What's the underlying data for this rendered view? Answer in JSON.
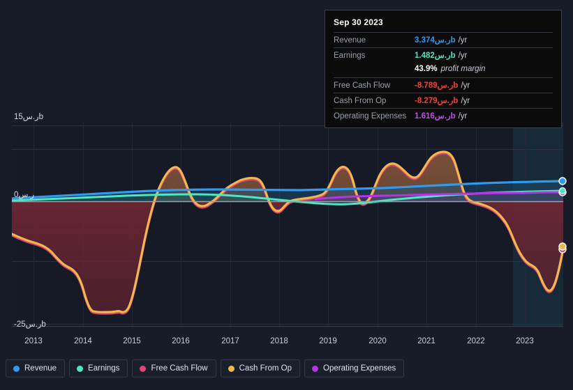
{
  "tooltip": {
    "date": "Sep 30 2023",
    "rows": [
      {
        "label": "Revenue",
        "value": "3.374ر.سb",
        "unit": "/yr",
        "color": "#2e9bf0"
      },
      {
        "label": "Earnings",
        "value": "1.482ر.سb",
        "unit": "/yr",
        "color": "#4de8c2"
      },
      {
        "label": "Free Cash Flow",
        "value": "-8.789ر.سb",
        "unit": "/yr",
        "color": "#f2413c"
      },
      {
        "label": "Cash From Op",
        "value": "-8.279ر.سb",
        "unit": "/yr",
        "color": "#f2413c"
      },
      {
        "label": "Operating Expenses",
        "value": "1.616ر.سb",
        "unit": "/yr",
        "color": "#c44ef0"
      }
    ],
    "margin_value": "43.9%",
    "margin_label": "profit margin"
  },
  "axes": {
    "y_top_label": "15ر.سb",
    "y_zero_label": "0ر.س",
    "y_bottom_label": "-25ر.سb",
    "x_labels": [
      "2013",
      "2014",
      "2015",
      "2016",
      "2017",
      "2018",
      "2019",
      "2020",
      "2021",
      "2022",
      "2023"
    ]
  },
  "legend": [
    {
      "label": "Revenue",
      "color": "#2e9bf0"
    },
    {
      "label": "Earnings",
      "color": "#4de8c2"
    },
    {
      "label": "Free Cash Flow",
      "color": "#e0457b"
    },
    {
      "label": "Cash From Op",
      "color": "#f2b84b"
    },
    {
      "label": "Operating Expenses",
      "color": "#b832e8"
    }
  ],
  "colors": {
    "revenue": "#2e9bf0",
    "earnings": "#4de8c2",
    "free_cash_flow": "#e0457b",
    "cash_from_op": "#f2b84b",
    "operating_expenses": "#b832e8",
    "page_background": "#171c28",
    "plot_background": "#151a26",
    "gridline": "#2a3140",
    "zero_line": "#9aa0ab",
    "negative_fill": "#6b2430",
    "forecast_band": "#18303c"
  },
  "chart_data": {
    "type": "area",
    "title": "",
    "xlabel": "",
    "ylabel": "",
    "ylim": [
      -25,
      15
    ],
    "xlim": [
      2012.6,
      2024.0
    ],
    "grid": true,
    "legend_position": "bottom",
    "y_ticks": [
      15,
      10,
      0,
      -12.5,
      -25
    ],
    "x_ticks": [
      2013,
      2014,
      2015,
      2016,
      2017,
      2018,
      2019,
      2020,
      2021,
      2022,
      2023
    ],
    "forecast_starts_at": 2022.85,
    "currency_unit": "ر.سb",
    "x": [
      2012.7,
      2013.0,
      2013.3,
      2013.6,
      2013.9,
      2014.2,
      2014.5,
      2014.8,
      2015.1,
      2015.4,
      2015.7,
      2016.0,
      2016.3,
      2016.6,
      2016.9,
      2017.2,
      2017.5,
      2017.8,
      2018.1,
      2018.4,
      2018.7,
      2019.0,
      2019.3,
      2019.6,
      2019.9,
      2020.2,
      2020.5,
      2020.8,
      2021.1,
      2021.4,
      2021.7,
      2022.0,
      2022.3,
      2022.6,
      2022.9,
      2023.2,
      2023.5,
      2023.75
    ],
    "series": [
      {
        "name": "Revenue",
        "color": "#2e9bf0",
        "values": [
          0.55,
          0.6,
          0.68,
          0.78,
          0.88,
          0.98,
          1.1,
          1.22,
          1.35,
          1.48,
          1.6,
          1.72,
          1.8,
          1.86,
          1.9,
          1.92,
          1.9,
          1.86,
          1.82,
          1.8,
          1.82,
          1.9,
          2.0,
          2.1,
          2.16,
          2.2,
          2.24,
          2.3,
          2.4,
          2.5,
          2.58,
          2.66,
          2.78,
          2.92,
          3.08,
          3.22,
          3.32,
          3.374
        ],
        "endpoint_value": 3.374
      },
      {
        "name": "Earnings",
        "color": "#4de8c2",
        "values": [
          0.05,
          0.1,
          0.18,
          0.26,
          0.35,
          0.44,
          0.54,
          0.64,
          0.74,
          0.84,
          0.92,
          0.98,
          1.02,
          1.04,
          1.04,
          1.02,
          0.98,
          0.92,
          0.84,
          0.78,
          0.74,
          0.72,
          0.7,
          0.6,
          0.45,
          0.38,
          0.4,
          0.5,
          0.64,
          0.78,
          0.9,
          1.0,
          1.1,
          1.2,
          1.3,
          1.4,
          1.45,
          1.482
        ],
        "endpoint_value": 1.482
      },
      {
        "name": "Operating Expenses",
        "color": "#b832e8",
        "values": [
          null,
          null,
          null,
          null,
          null,
          null,
          null,
          null,
          null,
          null,
          null,
          null,
          null,
          null,
          null,
          null,
          null,
          null,
          null,
          null,
          0.8,
          0.95,
          1.02,
          1.06,
          1.08,
          1.1,
          1.12,
          1.16,
          1.22,
          1.28,
          1.34,
          1.4,
          1.46,
          1.52,
          1.56,
          1.58,
          1.6,
          1.616
        ],
        "endpoint_value": 1.616
      },
      {
        "name": "Cash From Op",
        "color": "#f2b84b",
        "values": [
          -7.0,
          -8.2,
          -9.5,
          -11.5,
          -19.0,
          -22.6,
          -22.9,
          -21.8,
          -8.0,
          5.5,
          2.0,
          -0.5,
          2.6,
          3.4,
          3.9,
          4.6,
          0.6,
          -2.0,
          -0.4,
          0.6,
          0.9,
          1.2,
          6.0,
          7.6,
          1.0,
          6.8,
          8.0,
          5.4,
          7.0,
          7.6,
          11.4,
          11.5,
          1.2,
          -0.6,
          -2.4,
          -9.4,
          -11.8,
          -8.279
        ],
        "endpoint_value": -8.279
      },
      {
        "name": "Free Cash Flow",
        "color": "#e0457b",
        "values": [
          -7.2,
          -8.4,
          -9.7,
          -11.7,
          -19.2,
          -22.8,
          -23.1,
          -22.0,
          -8.2,
          5.3,
          1.8,
          -0.7,
          2.4,
          3.2,
          3.7,
          4.4,
          0.4,
          -2.2,
          -0.6,
          0.4,
          0.7,
          1.0,
          5.8,
          7.4,
          0.8,
          6.6,
          7.8,
          5.2,
          6.8,
          7.4,
          11.2,
          11.3,
          1.0,
          -0.8,
          -2.8,
          -9.9,
          -12.3,
          -8.789
        ],
        "endpoint_value": -8.789
      }
    ]
  }
}
